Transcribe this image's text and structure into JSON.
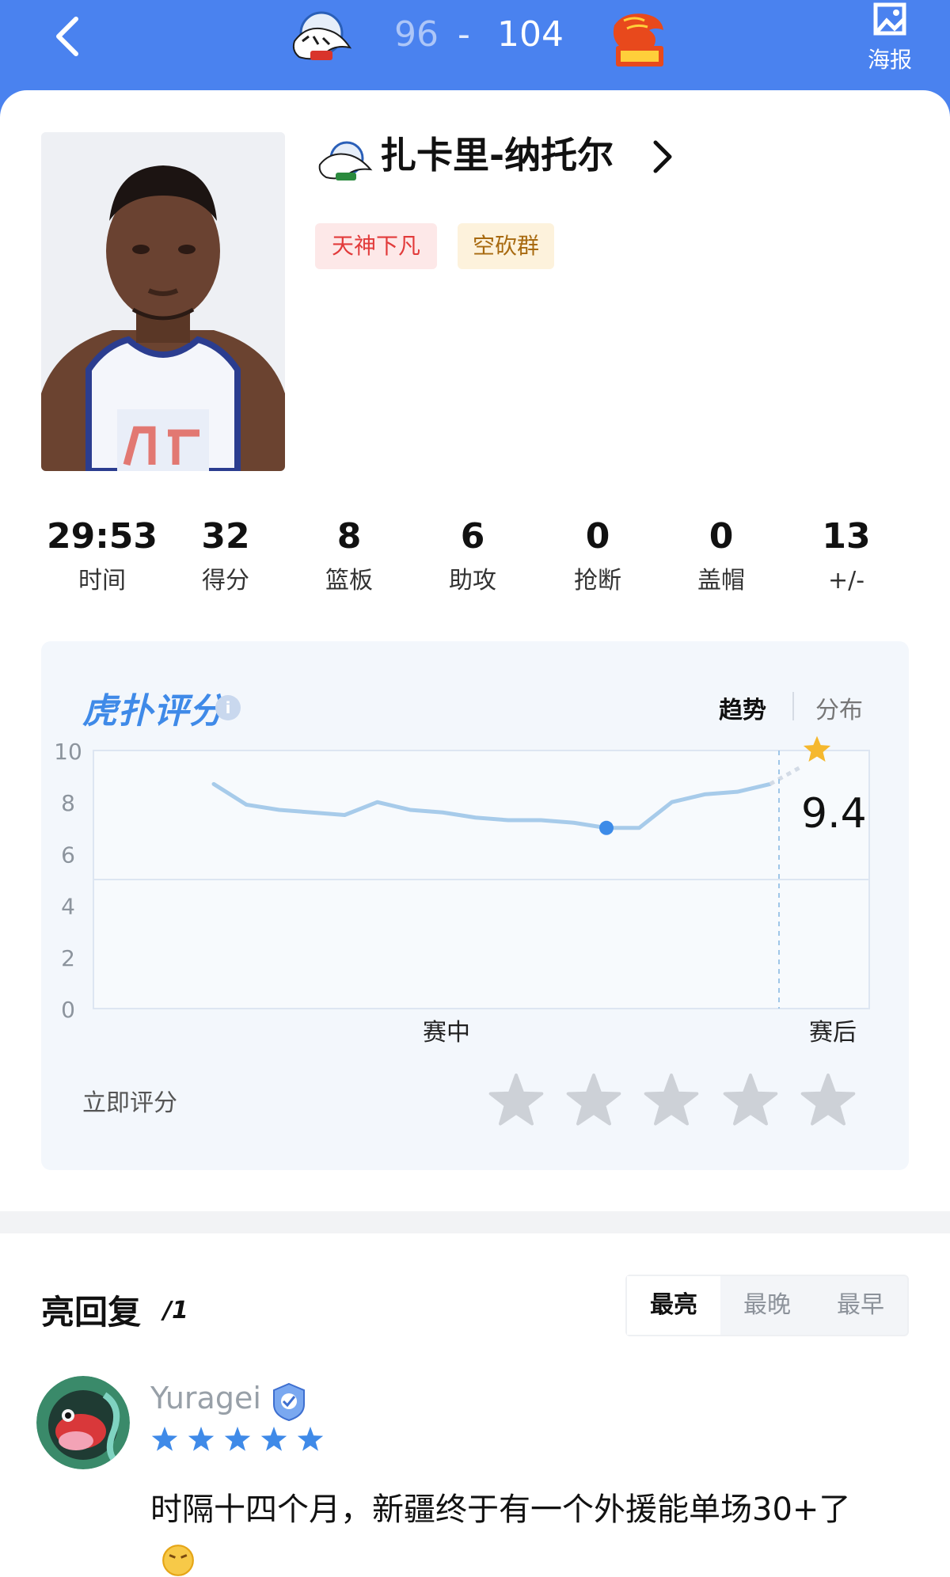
{
  "header": {
    "home_score": "96",
    "separator": "-",
    "away_score": "104",
    "home_team_icon": "xinjiang-tigers-logo",
    "away_team_icon": "shenzhen-leopards-logo",
    "poster_label": "海报",
    "colors": {
      "bar": "#4a82ef"
    }
  },
  "player": {
    "name": "扎卡里-纳托尔",
    "team_icon": "xinjiang-tigers-logo",
    "tags": [
      "天神下凡",
      "空砍群"
    ]
  },
  "stats": [
    {
      "value": "29:53",
      "label": "时间"
    },
    {
      "value": "32",
      "label": "得分"
    },
    {
      "value": "8",
      "label": "篮板"
    },
    {
      "value": "6",
      "label": "助攻"
    },
    {
      "value": "0",
      "label": "抢断"
    },
    {
      "value": "0",
      "label": "盖帽"
    },
    {
      "value": "13",
      "label": "+/-"
    }
  ],
  "rating": {
    "brand": "虎扑评分",
    "registered": "®",
    "info_icon": "i",
    "tabs": {
      "trend": "趋势",
      "distribution": "分布",
      "active": "趋势"
    },
    "current_score": "9.4",
    "rate_now_label": "立即评分",
    "rate_stars_total": 5,
    "rate_stars_selected": 0
  },
  "chart_data": {
    "type": "line",
    "ylim": [
      0,
      10
    ],
    "yticks": [
      "10",
      "8",
      "6",
      "4",
      "2",
      "0"
    ],
    "x_labels": [
      "赛中",
      "赛后"
    ],
    "series": [
      {
        "values": [
          8.7,
          7.9,
          7.7,
          7.6,
          7.5,
          8.0,
          7.7,
          7.6,
          7.4,
          7.3,
          7.3,
          7.2,
          7.0,
          7.0,
          8.0,
          8.3,
          8.4,
          8.7,
          9.4
        ]
      }
    ],
    "final_value": 9.4,
    "colors": {
      "line": "#a7cbea",
      "point": "#3d8be8",
      "star": "#f5b82e",
      "grid": "#dde6f2"
    }
  },
  "replies": {
    "title": "亮回复",
    "count": "/1",
    "sort_options": [
      "最亮",
      "最晚",
      "最早"
    ],
    "active_sort": "最亮",
    "items": [
      {
        "user": "Yuragei",
        "stars": 5,
        "text": "时隔十四个月，新疆终于有一个外援能单场30+了"
      }
    ]
  }
}
